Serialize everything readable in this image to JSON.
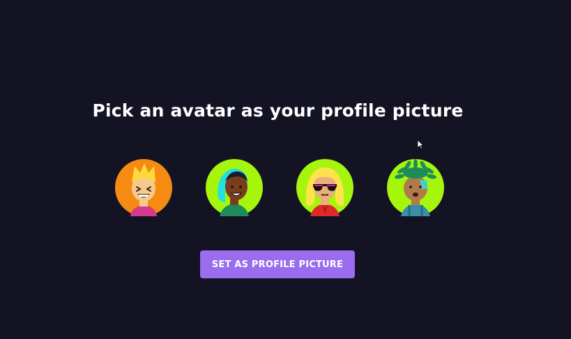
{
  "heading": "Pick an avatar as your profile picture",
  "avatars": [
    {
      "name": "avatar-1",
      "background": "#f58b12",
      "selected": false
    },
    {
      "name": "avatar-2",
      "background": "#a6f50d",
      "selected": false
    },
    {
      "name": "avatar-3",
      "background": "#a6f50d",
      "selected": false
    },
    {
      "name": "avatar-4",
      "background": "#a6f50d",
      "selected": false
    }
  ],
  "button": {
    "label": "SET AS PROFILE PICTURE",
    "color": "#9a6dee"
  },
  "colors": {
    "background": "#131324",
    "text": "#ffffff"
  }
}
